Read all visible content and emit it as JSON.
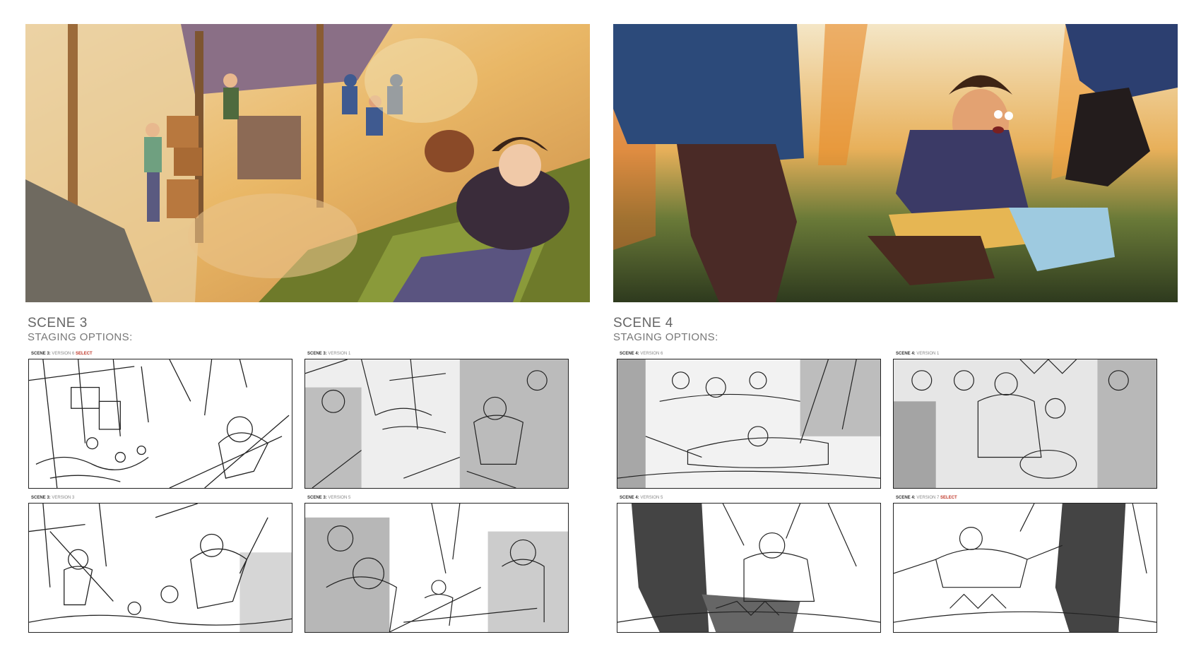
{
  "scene3": {
    "title": "SCENE 3",
    "subtitle": "STAGING OPTIONS:",
    "panels": [
      {
        "scene": "SCENE 3:",
        "version": "VERSION 6",
        "select": "SELECT"
      },
      {
        "scene": "SCENE 3:",
        "version": "VERSION 1",
        "select": ""
      },
      {
        "scene": "SCENE 3:",
        "version": "VERSION 3",
        "select": ""
      },
      {
        "scene": "SCENE 3:",
        "version": "VERSION 5",
        "select": ""
      }
    ]
  },
  "scene4": {
    "title": "SCENE 4",
    "subtitle": "STAGING OPTIONS:",
    "panels": [
      {
        "scene": "SCENE 4:",
        "version": "VERSION 6",
        "select": ""
      },
      {
        "scene": "SCENE 4:",
        "version": "VERSION 1",
        "select": ""
      },
      {
        "scene": "SCENE 4:",
        "version": "VERSION 5",
        "select": ""
      },
      {
        "scene": "SCENE 4:",
        "version": "VERSION 7",
        "select": "SELECT"
      }
    ]
  },
  "colors": {
    "select_red": "#c0392b",
    "painting3_warm": "#e8b86a",
    "painting4_green": "#3e4a2c"
  }
}
